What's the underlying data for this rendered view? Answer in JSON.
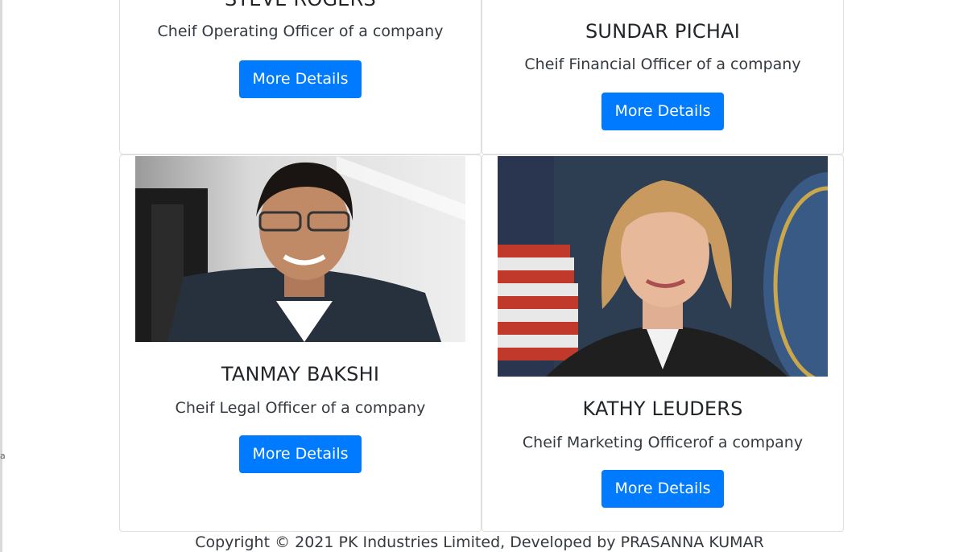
{
  "cards": [
    {
      "name": "STEVE ROGERS",
      "role": "Cheif Operating Officer of a company",
      "button": "More Details"
    },
    {
      "name": "SUNDAR PICHAI",
      "role": "Cheif Financial Officer of a company",
      "button": "More Details"
    },
    {
      "name": "TANMAY BAKSHI",
      "role": "Cheif Legal Officer of a company",
      "button": "More Details"
    },
    {
      "name": "KATHY LEUDERS",
      "role": "Cheif Marketing Officerof a company",
      "button": "More Details"
    }
  ],
  "footer": {
    "text": "Copyright © 2021 PK Industries Limited, Developed by PRASANNA KUMAR"
  },
  "colors": {
    "primary": "#007bff",
    "text": "#212529",
    "border": "#dfdfdf"
  }
}
